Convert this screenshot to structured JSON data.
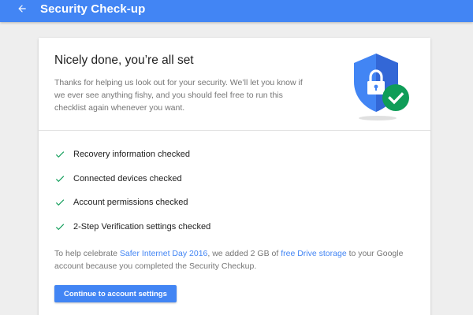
{
  "header": {
    "title": "Security Check-up",
    "back_icon": "arrow-back-icon",
    "bar_color": "#4285f4"
  },
  "card": {
    "title": "Nicely done, you’re all set",
    "body": "Thanks for helping us look out for your security. We’ll let you know if we ever see anything fishy, and you should feel free to run this checklist again whenever you want.",
    "illustration": "shield-lock-check-icon",
    "checks": [
      "Recovery information checked",
      "Connected devices checked",
      "Account permissions checked",
      "2-Step Verification settings checked"
    ],
    "check_icon": "checkmark-icon",
    "check_color": "#0f9d58",
    "promo": {
      "before": "To help celebrate ",
      "link1": "Safer Internet Day 2016",
      "middle": ", we added 2 GB of ",
      "link2": "free Drive storage",
      "after": " to your Google account because you completed the Security Checkup."
    },
    "button_label": "Continue to account settings",
    "accent": "#4285f4"
  }
}
